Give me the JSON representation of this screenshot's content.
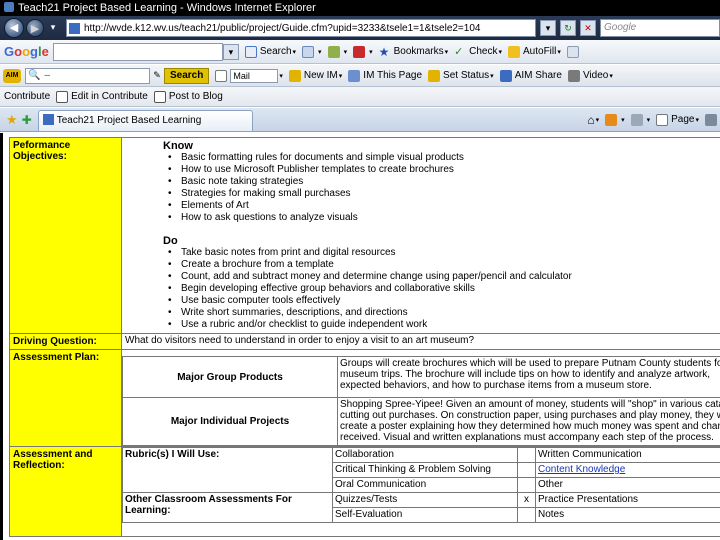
{
  "window": {
    "title": "Teach21 Project Based Learning - Windows Internet Explorer",
    "url": "http://wvde.k12.wv.us/teach21/public/project/Guide.cfm?upid=3233&tsele1=1&tsele2=104",
    "search_placeholder": "Google"
  },
  "google_toolbar": {
    "logo": [
      "G",
      "o",
      "o",
      "g",
      "l",
      "e"
    ],
    "items": [
      "Search",
      "Bookmarks",
      "Check",
      "AutoFill"
    ]
  },
  "aim_toolbar": {
    "logo": "AIM",
    "search_button": "Search",
    "items": [
      "Mail",
      "New IM",
      "IM This Page",
      "Set Status",
      "AIM Share",
      "Video"
    ]
  },
  "contribute_bar": {
    "items": [
      "Contribute",
      "Edit in Contribute",
      "Post to Blog"
    ]
  },
  "tab": {
    "title": "Teach21 Project Based Learning",
    "page_menu": "Page"
  },
  "content": {
    "objectives": {
      "label": "Peformance Objectives:",
      "know_heading": "Know",
      "know_items": [
        "Basic formatting rules for documents and simple visual products",
        "How to use Microsoft Publisher templates to create brochures",
        "Basic note taking strategies",
        "Strategies for making small purchases",
        "Elements of Art",
        "How to ask questions to analyze visuals"
      ],
      "do_heading": "Do",
      "do_items": [
        "Take basic notes from print and digital resources",
        "Create a brochure from a template",
        "Count, add and subtract money and determine change using paper/pencil and calculator",
        "Begin developing effective group behaviors and collaborative skills",
        "Use basic computer tools effectively",
        "Write short summaries, descriptions, and directions",
        "Use a rubric and/or checklist to guide independent work"
      ]
    },
    "driving_question": {
      "label": "Driving Question:",
      "text": "What do visitors need to understand in order to enjoy a visit to an art museum?"
    },
    "assessment_plan": {
      "label": "Assessment Plan:",
      "group_label": "Major Group Products",
      "group_text": "Groups will create brochures which will be used to prepare Putnam County students for museum trips.  The brochure will include tips on how to identify and analyze artwork, expected behaviors, and how to purchase items from a museum store.",
      "individual_label": "Major Individual Projects",
      "individual_text": "Shopping Spree-Yipee! Given an amount of money, students will \"shop\" in various catalogs cutting out purchases.  On construction paper, using purchases and play money, they will create a poster explaining how they determined how much money was spent and change received.   Visual and written explanations must accompany each step of the process."
    },
    "assessment_reflection": {
      "label": "Assessment and Reflection:",
      "rubric_label": "Rubric(s) I Will Use:",
      "rubric_rows": [
        [
          "Collaboration",
          "",
          "Written Communication"
        ],
        [
          "Critical Thinking & Problem Solving",
          "",
          "Content Knowledge"
        ],
        [
          "Oral Communication",
          "",
          "Other"
        ]
      ],
      "other_label": "Other Classroom Assessments For Learning:",
      "other_rows": [
        [
          "Quizzes/Tests",
          "x",
          "Practice Presentations"
        ],
        [
          "Self-Evaluation",
          "",
          "Notes"
        ]
      ]
    }
  }
}
